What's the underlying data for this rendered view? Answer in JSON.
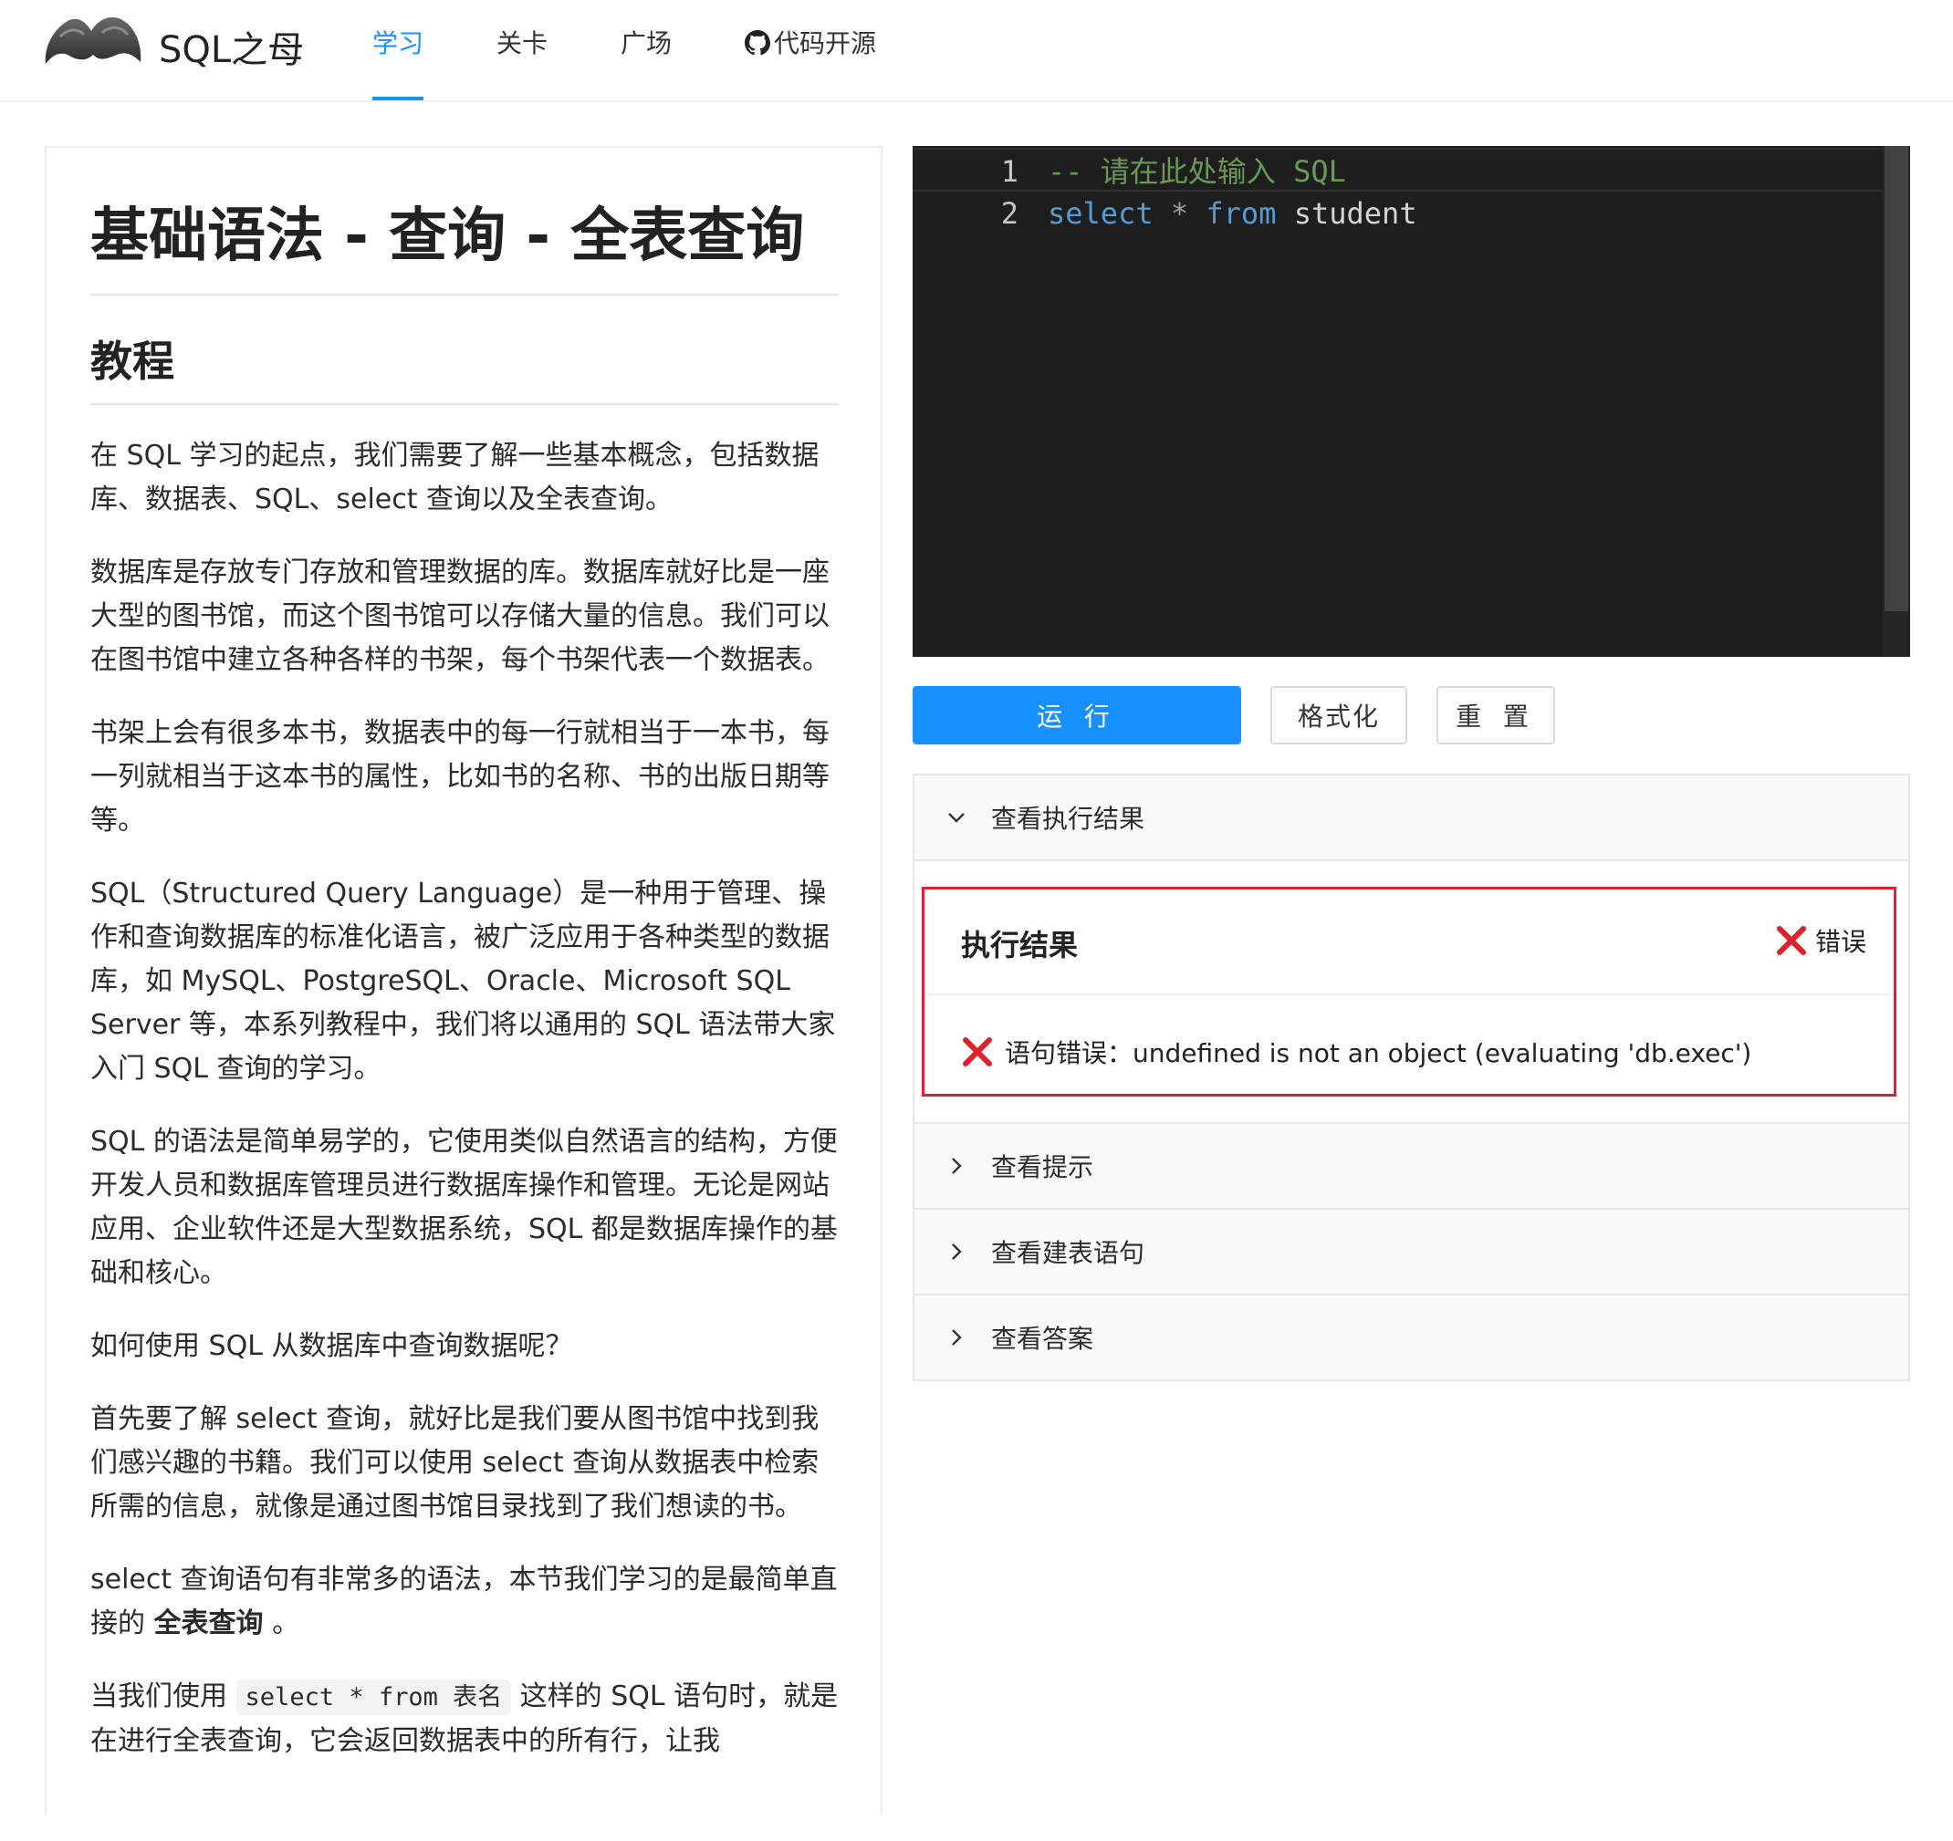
{
  "header": {
    "brand": "SQL之母",
    "nav": [
      {
        "label": "学习",
        "active": true
      },
      {
        "label": "关卡",
        "active": false
      },
      {
        "label": "广场",
        "active": false
      },
      {
        "label": "代码开源",
        "icon": "github-icon",
        "active": false
      }
    ],
    "accent_color": "#1890ff"
  },
  "article": {
    "title": "基础语法 - 查询 - 全表查询",
    "section": "教程",
    "paragraphs": [
      "在 SQL 学习的起点，我们需要了解一些基本概念，包括数据库、数据表、SQL、select 查询以及全表查询。",
      "数据库是存放专门存放和管理数据的库。数据库就好比是一座大型的图书馆，而这个图书馆可以存储大量的信息。我们可以在图书馆中建立各种各样的书架，每个书架代表一个数据表。",
      "书架上会有很多本书，数据表中的每一行就相当于一本书，每一列就相当于这本书的属性，比如书的名称、书的出版日期等等。",
      "SQL（Structured Query Language）是一种用于管理、操作和查询数据库的标准化语言，被广泛应用于各种类型的数据库，如 MySQL、PostgreSQL、Oracle、Microsoft SQL Server 等，本系列教程中，我们将以通用的 SQL 语法带大家入门 SQL 查询的学习。",
      "SQL 的语法是简单易学的，它使用类似自然语言的结构，方便开发人员和数据库管理员进行数据库操作和管理。无论是网站应用、企业软件还是大型数据系统，SQL 都是数据库操作的基础和核心。",
      "如何使用 SQL 从数据库中查询数据呢？",
      "首先要了解 select 查询，就好比是我们要从图书馆中找到我们感兴趣的书籍。我们可以使用 select 查询从数据表中检索所需的信息，就像是通过图书馆目录找到了我们想读的书。"
    ],
    "p8_before": "select 查询语句有非常多的语法，本节我们学习的是最简单直接的 ",
    "p8_bold": "全表查询",
    "p8_after": " 。",
    "p9_before": "当我们使用 ",
    "p9_code": "select * from 表名",
    "p9_after": " 这样的 SQL 语句时，就是在进行全表查询，它会返回数据表中的所有行，让我"
  },
  "editor": {
    "lines": [
      {
        "num": "1",
        "tokens": [
          {
            "t": "-- 请在此处输入 SQL",
            "c": "comment"
          }
        ]
      },
      {
        "num": "2",
        "tokens": [
          {
            "t": "select",
            "c": "kw"
          },
          {
            "t": " ",
            "c": "id"
          },
          {
            "t": "*",
            "c": "op"
          },
          {
            "t": " ",
            "c": "id"
          },
          {
            "t": "from",
            "c": "kw"
          },
          {
            "t": " ",
            "c": "id"
          },
          {
            "t": "student",
            "c": "id"
          }
        ]
      }
    ]
  },
  "buttons": {
    "run": "运 行",
    "format": "格式化",
    "reset": "重 置"
  },
  "panels": {
    "result_header": "查看执行结果",
    "result_title": "执行结果",
    "status": "错误",
    "error_message": "语句错误：undefined is not an object (evaluating 'db.exec')",
    "hint": "查看提示",
    "create_table": "查看建表语句",
    "answer": "查看答案",
    "error_color": "#e0202a"
  }
}
